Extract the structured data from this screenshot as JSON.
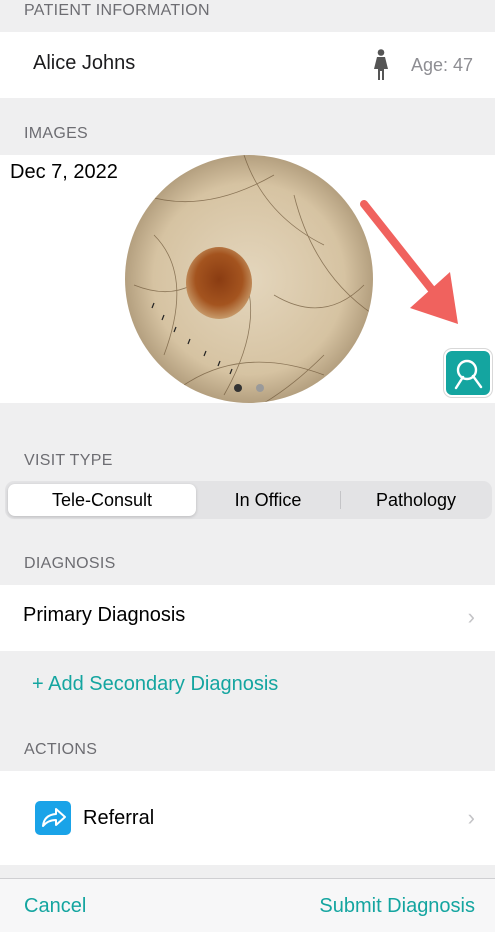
{
  "patient_section": {
    "header": "PATIENT INFORMATION",
    "name": "Alice Johns",
    "gender_icon": "female-person-icon",
    "age": "Age: 47"
  },
  "images_section": {
    "header": "IMAGES",
    "date": "Dec 7, 2022",
    "image_subject": "dermoscopy-lesion-image",
    "page_count": 2,
    "current_page": 1,
    "analyze_button_icon": "magnifier-analysis-icon"
  },
  "visit_type": {
    "header": "VISIT TYPE",
    "options": [
      "Tele-Consult",
      "In Office",
      "Pathology"
    ],
    "selected": "Tele-Consult"
  },
  "diagnosis": {
    "header": "DIAGNOSIS",
    "primary_label": "Primary Diagnosis",
    "add_secondary": "+ Add Secondary Diagnosis"
  },
  "actions": {
    "header": "ACTIONS",
    "referral_label": "Referral",
    "referral_icon": "share-arrow-icon"
  },
  "bottom_bar": {
    "cancel": "Cancel",
    "submit": "Submit Diagnosis"
  },
  "colors": {
    "accent": "#14a5a0",
    "referral_icon_bg": "#1aa3e8",
    "annotation_arrow": "#f0625e"
  }
}
